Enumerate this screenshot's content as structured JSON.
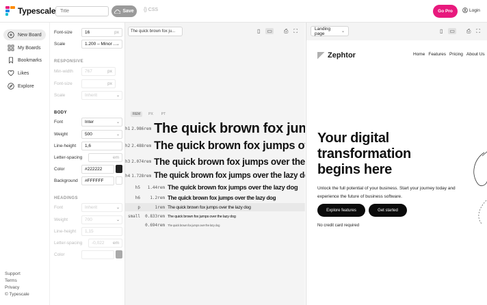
{
  "topbar": {
    "logo_text": "Typescale",
    "title_placeholder": "Title",
    "save_label": "Save",
    "css_label": "CSS",
    "gopro_label": "Go Pro",
    "login_label": "Login",
    "accent_color": "#e8197d"
  },
  "leftnav": {
    "items": [
      {
        "label": "New Board",
        "icon": "plus-circle-icon"
      },
      {
        "label": "My Boards",
        "icon": "grid-icon"
      },
      {
        "label": "Bookmarks",
        "icon": "bookmark-icon"
      },
      {
        "label": "Likes",
        "icon": "heart-icon"
      },
      {
        "label": "Explore",
        "icon": "compass-icon"
      }
    ],
    "footer": [
      "Support",
      "Terms",
      "Privacy",
      "© Typescale"
    ]
  },
  "settings": {
    "font_size_label": "Font-size",
    "font_size_value": "16",
    "font_size_unit": "px",
    "scale_label": "Scale",
    "scale_value": "1.200 – Minor …",
    "responsive_head": "RESPONSIVE",
    "min_width_label": "Min-width",
    "min_width_value": "767",
    "min_width_unit": "px",
    "resp_font_size_label": "Font-size",
    "resp_font_size_unit": "px",
    "resp_scale_label": "Scale",
    "resp_scale_value": "Inherit",
    "body_head": "BODY",
    "font_label": "Font",
    "font_value": "Inter",
    "weight_label": "Weight",
    "weight_value": "500",
    "line_height_label": "Line-height",
    "line_height_value": "1,6",
    "letter_spacing_label": "Letter-spacing",
    "letter_spacing_unit": "em",
    "color_label": "Color",
    "color_value": "#222222",
    "background_label": "Background",
    "background_value": "#FFFFFF",
    "headings_head": "HEADINGS",
    "h_font_label": "Font",
    "h_font_value": "Inherit",
    "h_weight_label": "Weight",
    "h_weight_value": "700",
    "h_line_height_label": "Line-height",
    "h_line_height_value": "1,15",
    "h_letter_spacing_label": "Letter-spacing",
    "h_letter_spacing_value": "-0,022",
    "h_letter_spacing_unit": "em",
    "h_color_label": "Color"
  },
  "center": {
    "preview_text": "The quick brown fox ju...",
    "unit_tabs": [
      "REM",
      "PX",
      "PT"
    ],
    "rows": [
      {
        "tag": "h1",
        "value": "2.986rem",
        "sample": "The quick brown fox jumps over the lazy dog"
      },
      {
        "tag": "h2",
        "value": "2.488rem",
        "sample": "The quick brown fox jumps over the lazy dog"
      },
      {
        "tag": "h3",
        "value": "2.074rem",
        "sample": "The quick brown fox jumps over the lazy dog"
      },
      {
        "tag": "h4",
        "value": "1.728rem",
        "sample": "The quick brown fox jumps over the lazy dog"
      },
      {
        "tag": "h5",
        "value": "1.44rem",
        "sample": "The quick brown fox jumps over the lazy dog"
      },
      {
        "tag": "h6",
        "value": "1.2rem",
        "sample": "The quick brown fox jumps over the lazy dog"
      },
      {
        "tag": "p",
        "value": "1rem",
        "sample": "The quick brown fox jumps over the lazy dog"
      },
      {
        "tag": "small",
        "value": "0.833rem",
        "sample": "The quick brown fox jumps over the lazy dog"
      },
      {
        "tag": "",
        "value": "0.694rem",
        "sample": "The quick brown fox jumps over the lazy dog"
      }
    ]
  },
  "right": {
    "select_value": "Landing page",
    "brand": "Zephtor",
    "nav": [
      "Home",
      "Features",
      "Pricing",
      "About Us"
    ],
    "hero": "Your digital transformation begins here",
    "sub": "Unlock the full potential of your business. Start your journey today and experience the future of business software.",
    "btn_primary": "Explore features",
    "btn_secondary": "Get started",
    "note": "No credit card required"
  }
}
